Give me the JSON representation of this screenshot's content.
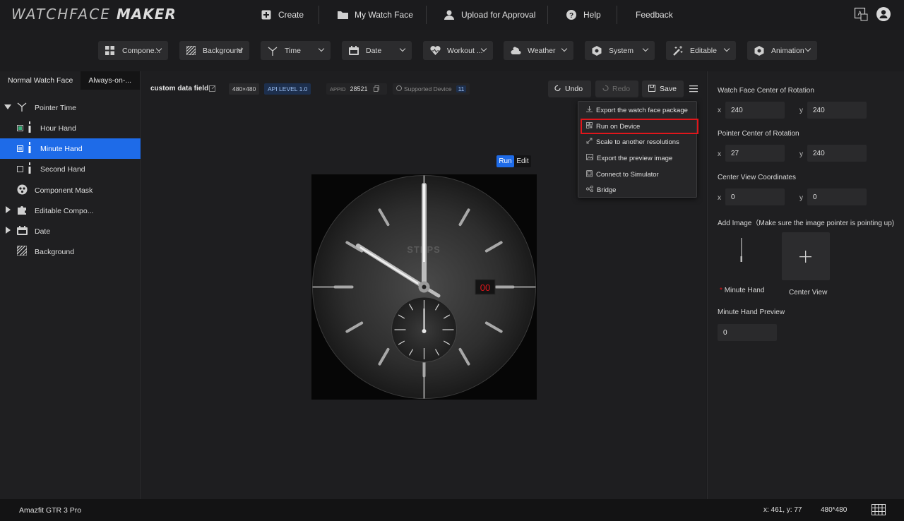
{
  "app": {
    "logo_thin": "WATCHFACE",
    "logo_bold": "MAKER"
  },
  "nav": {
    "create": "Create",
    "my_watch_face": "My Watch Face",
    "upload": "Upload for Approval",
    "help": "Help",
    "feedback": "Feedback"
  },
  "components": [
    {
      "label": "Compone...",
      "icon": "grid-icon"
    },
    {
      "label": "Background",
      "icon": "hatch-icon"
    },
    {
      "label": "Time",
      "icon": "clock-hands-icon"
    },
    {
      "label": "Date",
      "icon": "calendar-icon"
    },
    {
      "label": "Workout ...",
      "icon": "heart-icon"
    },
    {
      "label": "Weather",
      "icon": "cloud-sun-icon"
    },
    {
      "label": "System",
      "icon": "hexagon-icon"
    },
    {
      "label": "Editable",
      "icon": "magic-wand-icon"
    },
    {
      "label": "Animation",
      "icon": "hexagon-icon"
    }
  ],
  "left": {
    "tab_normal": "Normal Watch Face",
    "tab_aod": "Always-on-...",
    "tree": [
      {
        "label": "Pointer Time"
      },
      {
        "label": "Hour Hand"
      },
      {
        "label": "Minute Hand"
      },
      {
        "label": "Second Hand"
      },
      {
        "label": "Component Mask"
      },
      {
        "label": "Editable Compo..."
      },
      {
        "label": "Date"
      },
      {
        "label": "Background"
      }
    ]
  },
  "toolbar": {
    "project_name": "custom data field",
    "resolution": "480×480",
    "api_level": "API LEVEL 1.0",
    "appid_label": "APPID",
    "appid_value": "28521",
    "supported_device_label": "Supported Device",
    "supported_device_count": "11",
    "undo": "Undo",
    "redo": "Redo",
    "save": "Save"
  },
  "preview": {
    "run": "Run",
    "edit": "Edit",
    "brand_text": "STEPS",
    "date_value": "00"
  },
  "menu": {
    "items": [
      {
        "label": "Export the watch face package"
      },
      {
        "label": "Run on Device"
      },
      {
        "label": "Scale to another resolutions"
      },
      {
        "label": "Export the preview image"
      },
      {
        "label": "Connect to Simulator"
      },
      {
        "label": "Bridge"
      }
    ]
  },
  "right": {
    "center_rotation_label": "Watch Face Center of Rotation",
    "center_rotation_x": "240",
    "center_rotation_y": "240",
    "pointer_center_label": "Pointer Center of Rotation",
    "pointer_center_x": "27",
    "pointer_center_y": "240",
    "center_view_label": "Center View Coordinates",
    "center_view_x": "0",
    "center_view_y": "0",
    "x_label": "x",
    "y_label": "y",
    "add_image_label": "Add Image（Make sure the image pointer is pointing up)",
    "minute_hand_caption": "Minute Hand",
    "required_mark": "*",
    "center_view_caption": "Center View",
    "preview_label": "Minute Hand Preview",
    "preview_value": "0"
  },
  "status": {
    "device": "Amazfit GTR 3 Pro",
    "coords": "x: 461, y: 77",
    "resolution": "480*480"
  },
  "colors": {
    "accent": "#1e6be8",
    "highlight_border": "#e0161b",
    "date_text": "#e0161b"
  }
}
